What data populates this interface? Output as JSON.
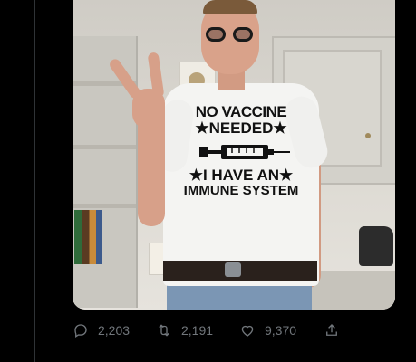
{
  "tweet": {
    "shirt_text": {
      "line1": "NO VACCINE",
      "line2": "★NEEDED★",
      "line3": "★I HAVE AN★",
      "line4": "IMMUNE SYSTEM"
    },
    "actions": {
      "reply": {
        "icon": "reply-icon",
        "count": "2,203"
      },
      "retweet": {
        "icon": "retweet-icon",
        "count": "2,191"
      },
      "like": {
        "icon": "heart-icon",
        "count": "9,370"
      },
      "share": {
        "icon": "share-icon"
      }
    }
  },
  "colors": {
    "background": "#000000",
    "action_text": "#71767b",
    "divider": "#2f3336"
  }
}
